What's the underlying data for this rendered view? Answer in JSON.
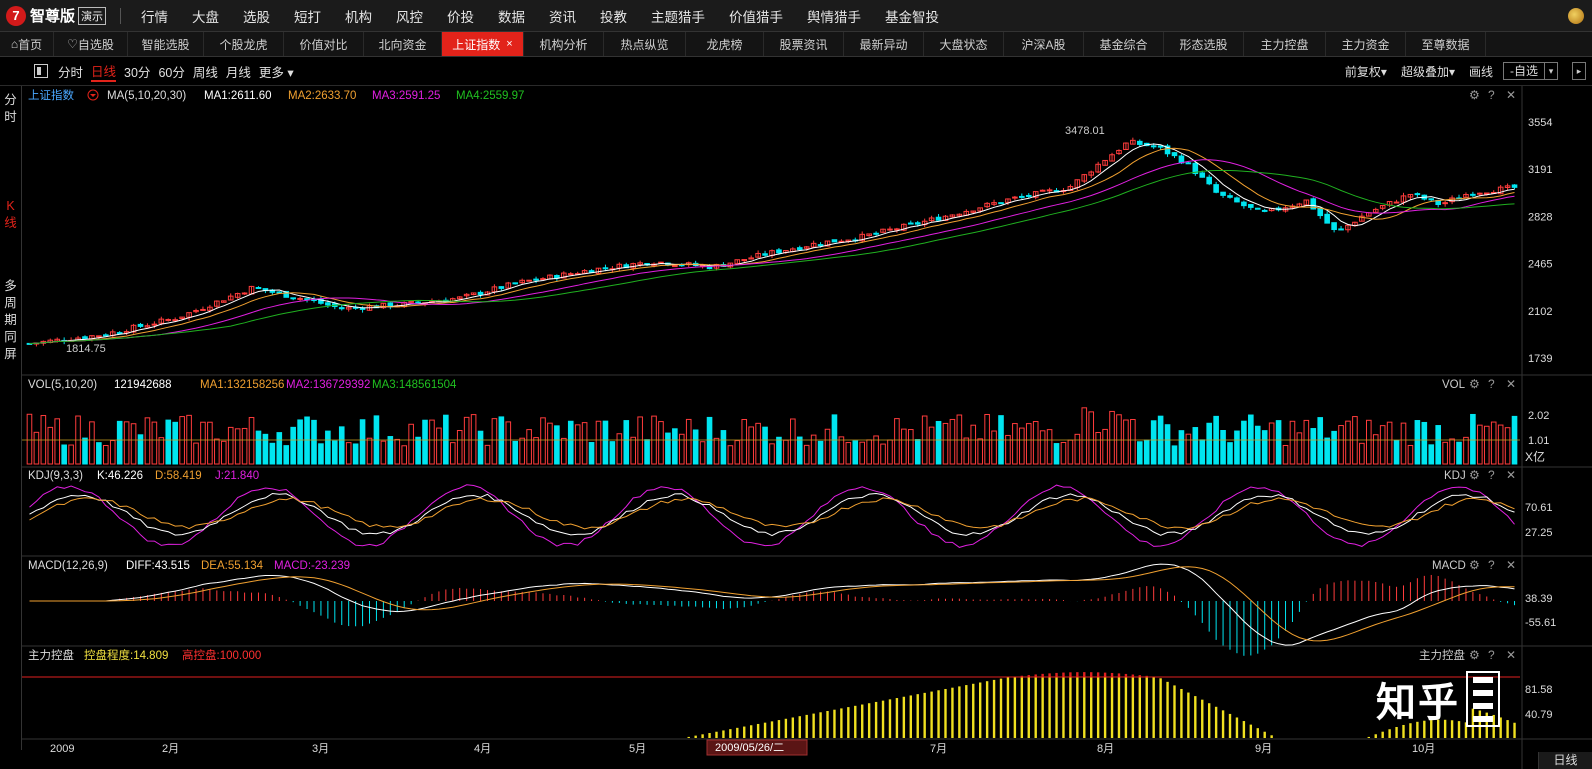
{
  "app": {
    "logo_mark": "7",
    "name": "智尊版",
    "badge": "演示"
  },
  "menu": [
    "行情",
    "大盘",
    "选股",
    "短打",
    "机构",
    "风控",
    "价投",
    "数据",
    "资讯",
    "投教",
    "主题猎手",
    "价值猎手",
    "舆情猎手",
    "基金智投"
  ],
  "tabs": [
    {
      "label": "首页",
      "icon": "home-icon"
    },
    {
      "label": "自选股",
      "icon": "heart-icon"
    },
    {
      "label": "智能选股"
    },
    {
      "label": "个股龙虎"
    },
    {
      "label": "价值对比"
    },
    {
      "label": "北向资金"
    },
    {
      "label": "上证指数",
      "active": true,
      "close": "×"
    },
    {
      "label": "机构分析"
    },
    {
      "label": "热点纵览"
    },
    {
      "label": "龙虎榜"
    },
    {
      "label": "股票资讯"
    },
    {
      "label": "最新异动"
    },
    {
      "label": "大盘状态"
    },
    {
      "label": "沪深A股"
    },
    {
      "label": "基金综合"
    },
    {
      "label": "形态选股"
    },
    {
      "label": "主力控盘"
    },
    {
      "label": "主力资金"
    },
    {
      "label": "至尊数据"
    }
  ],
  "toolbar": {
    "periods": [
      "分时",
      "日线",
      "30分",
      "60分",
      "周线",
      "月线",
      "更多 ▾"
    ],
    "selected": "日线",
    "right": [
      "前复权▾",
      "超级叠加▾",
      "画线"
    ],
    "picker": "-自选",
    "picker_arrow": "▾",
    "side_arrow": "▸"
  },
  "leftnav": {
    "intraday": "分时",
    "kline": "K线",
    "multi": "多周期同屏"
  },
  "panels": {
    "kline": {
      "title": "上证指数",
      "indicator": "MA(5,10,20,30)",
      "ma1": "MA1:2611.60",
      "ma2": "MA2:2633.70",
      "ma3": "MA3:2591.25",
      "ma4": "MA4:2559.97",
      "high_label": "3478.01",
      "low_label": "1814.75",
      "yticks": [
        "3554",
        "3191",
        "2828",
        "2465",
        "2102",
        "1739"
      ]
    },
    "vol": {
      "name": "VOL(5,10,20)",
      "value": "121942688",
      "ma1": "MA1:132158256",
      "ma2": "MA2:136729392",
      "ma3": "MA3:148561504",
      "tag": "VOL",
      "yticks": [
        "2.02",
        "1.01",
        "X亿"
      ]
    },
    "kdj": {
      "name": "KDJ(9,3,3)",
      "k": "K:46.226",
      "d": "D:58.419",
      "j": "J:21.840",
      "tag": "KDJ",
      "yticks": [
        "70.61",
        "27.25"
      ]
    },
    "macd": {
      "name": "MACD(12,26,9)",
      "diff": "DIFF:43.515",
      "dea": "DEA:55.134",
      "macd": "MACD:-23.239",
      "tag": "MACD",
      "yticks": [
        "38.39",
        "-55.61"
      ]
    },
    "control": {
      "name": "主力控盘",
      "degree": "控盘程度:14.809",
      "high": "高控盘:100.000",
      "tag": "主力控盘",
      "yticks": [
        "81.58",
        "40.79"
      ]
    }
  },
  "xaxis": {
    "labels": [
      "2009",
      "2月",
      "3月",
      "4月",
      "5月",
      "6月",
      "7月",
      "8月",
      "9月",
      "10月"
    ],
    "cursor_date": "2009/05/26/二",
    "period_label": "日线"
  },
  "colors": {
    "up": "#ff3c3c",
    "down": "#00e5f0",
    "ma1": "#ffffff",
    "ma2": "#f0a030",
    "ma3": "#e020e0",
    "ma4": "#20b020",
    "accent": "#e2231a"
  },
  "watermark": {
    "text": "知乎"
  },
  "chart_data": [
    {
      "type": "candlestick",
      "title": "上证指数",
      "x_months": [
        "2009",
        "2月",
        "3月",
        "4月",
        "5月",
        "6月",
        "7月",
        "8月",
        "9月",
        "10月"
      ],
      "ylim": [
        1739,
        3554
      ],
      "annotations": {
        "high": 3478.01,
        "low": 1814.75
      },
      "close_trend": [
        [
          0,
          1850
        ],
        [
          0.05,
          1920
        ],
        [
          0.1,
          2050
        ],
        [
          0.15,
          2280
        ],
        [
          0.19,
          2180
        ],
        [
          0.21,
          2120
        ],
        [
          0.25,
          2150
        ],
        [
          0.29,
          2200
        ],
        [
          0.33,
          2320
        ],
        [
          0.38,
          2420
        ],
        [
          0.42,
          2480
        ],
        [
          0.46,
          2440
        ],
        [
          0.5,
          2550
        ],
        [
          0.53,
          2620
        ],
        [
          0.56,
          2670
        ],
        [
          0.6,
          2780
        ],
        [
          0.66,
          2960
        ],
        [
          0.7,
          3050
        ],
        [
          0.72,
          3230
        ],
        [
          0.74,
          3400
        ],
        [
          0.76,
          3360
        ],
        [
          0.78,
          3230
        ],
        [
          0.8,
          3000
        ],
        [
          0.83,
          2850
        ],
        [
          0.86,
          2950
        ],
        [
          0.88,
          2700
        ],
        [
          0.9,
          2850
        ],
        [
          0.93,
          3000
        ],
        [
          0.95,
          2920
        ],
        [
          0.97,
          3010
        ],
        [
          1.0,
          3050
        ]
      ]
    }
  ]
}
